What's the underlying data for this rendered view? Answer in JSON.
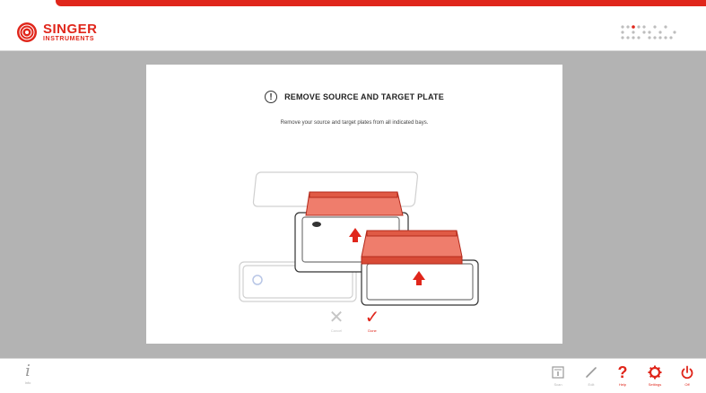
{
  "brand": {
    "name": "SINGER",
    "subtitle": "INSTRUMENTS",
    "color": "#e0261b"
  },
  "dialog": {
    "title": "REMOVE SOURCE AND TARGET PLATE",
    "message": "Remove your source and target plates from all indicated bays.",
    "cancel_label": "Cancel",
    "done_label": "Done"
  },
  "footer": {
    "info_label": "Info",
    "buttons": [
      {
        "label": "Scan",
        "icon": "scan-icon",
        "active": false
      },
      {
        "label": "Edit",
        "icon": "pencil-icon",
        "active": false
      },
      {
        "label": "Help",
        "icon": "question-icon",
        "active": true
      },
      {
        "label": "Settings",
        "icon": "gear-icon",
        "active": true
      },
      {
        "label": "Off",
        "icon": "power-icon",
        "active": true
      }
    ]
  },
  "colors": {
    "accent": "#e0261b",
    "plate_highlight": "#ef7d6c",
    "background": "#b3b3b3"
  }
}
